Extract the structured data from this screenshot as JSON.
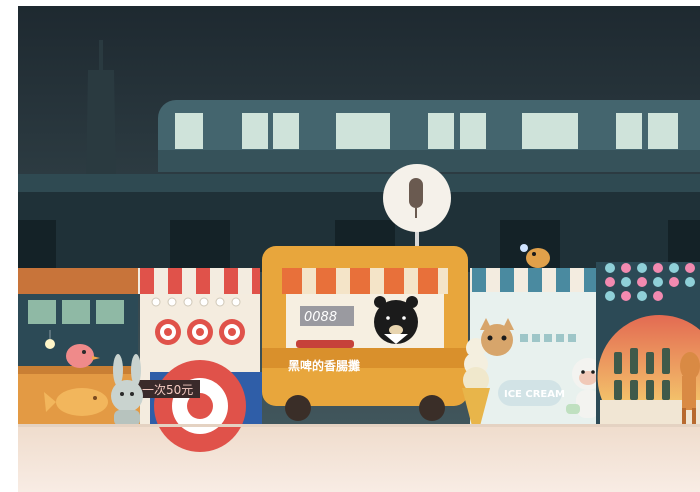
{
  "scene": {
    "sausage_stall_sign": "黑啤的香腸攤",
    "game_stall_price": "一次50元",
    "ice_cream_sign": "ICE CREAM",
    "menu_board_text": "0088"
  },
  "colors": {
    "sky_top": "#1f2b33",
    "sky_bottom": "#3b5058",
    "train_body": "#3f6068",
    "train_window": "#cfe4da",
    "sausage_cart": "#e8a63c",
    "awning_red": "#e0524a",
    "ground": "#f1e0cf"
  }
}
